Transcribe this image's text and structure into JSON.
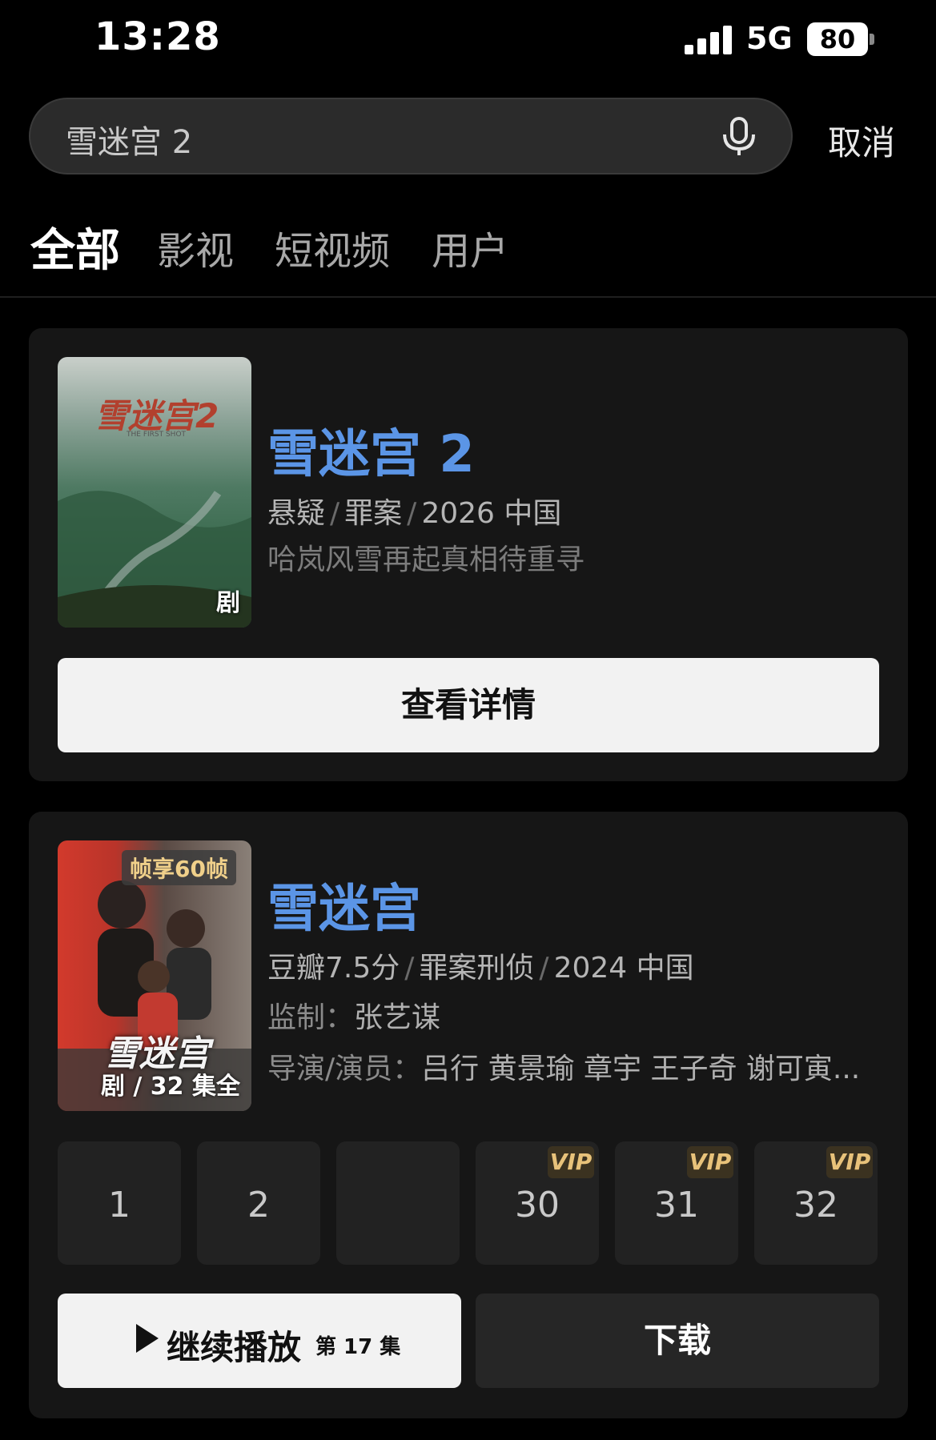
{
  "status_bar": {
    "time": "13:28",
    "network": "5G",
    "battery": "80"
  },
  "search": {
    "query": "雪迷宫 2",
    "cancel_label": "取消"
  },
  "tabs": [
    {
      "label": "全部",
      "active": true
    },
    {
      "label": "影视",
      "active": false
    },
    {
      "label": "短视频",
      "active": false
    },
    {
      "label": "用户",
      "active": false
    }
  ],
  "result1": {
    "title": "雪迷宫 2",
    "genre1": "悬疑",
    "genre2": "罪案",
    "year_region": "2026 中国",
    "tagline": "哈岚风雪再起真相待重寻",
    "poster_badge": "剧",
    "poster_title": "雪迷宫2",
    "poster_subtitle": "THE FIRST SHOT",
    "details_button": "查看详情"
  },
  "result2": {
    "title": "雪迷宫",
    "rating": "豆瓣7.5分",
    "genre": "罪案刑侦",
    "year_region": "2024 中国",
    "producer_label": "监制：",
    "producer": "张艺谋",
    "cast_label": "导演/演员：",
    "cast": "吕行 黄景瑜 章宇 王子奇 谢可寅...",
    "poster_tag": "帧享60帧",
    "poster_title": "雪迷宫",
    "poster_badge": "剧 / 32 集全",
    "episodes": [
      {
        "label": "1",
        "vip": false
      },
      {
        "label": "2",
        "vip": false
      },
      {
        "label": "",
        "vip": false
      },
      {
        "label": "30",
        "vip": true
      },
      {
        "label": "31",
        "vip": true
      },
      {
        "label": "32",
        "vip": true
      }
    ],
    "vip_label": "VIP",
    "continue_label": "继续播放",
    "continue_episode": "第 17 集",
    "download_label": "下载"
  }
}
